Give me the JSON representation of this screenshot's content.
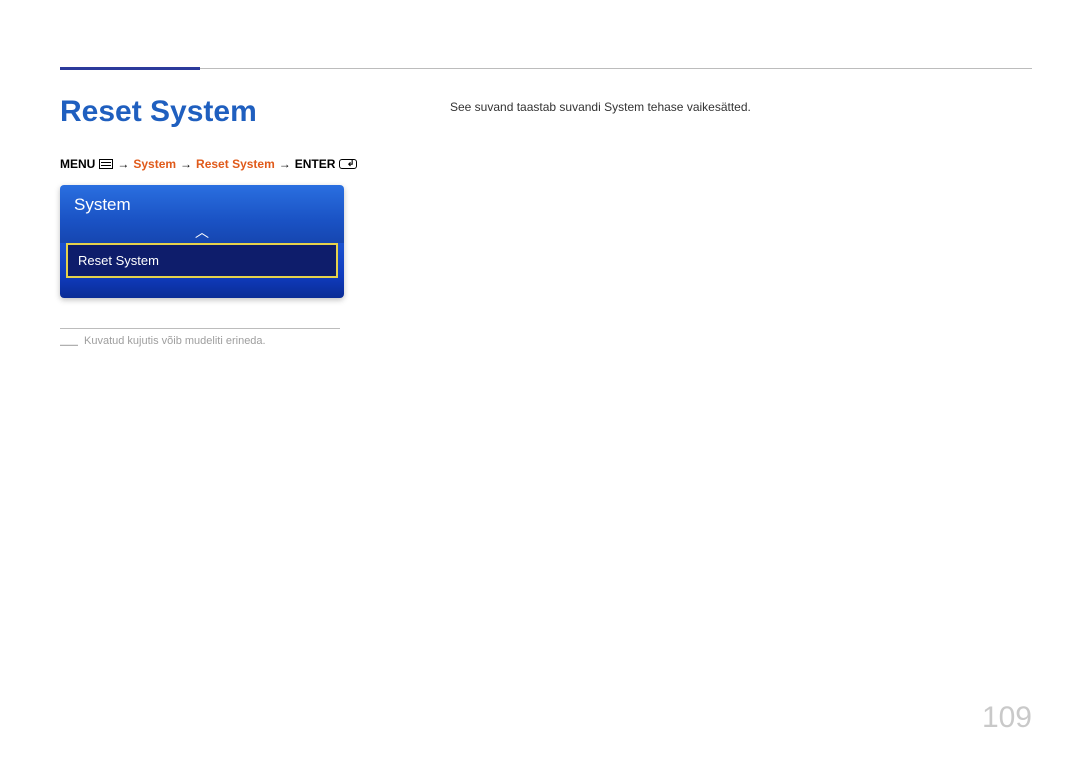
{
  "heading": "Reset System",
  "breadcrumb": {
    "menuLabel": "MENU",
    "arrow1": "→",
    "step1": "System",
    "arrow2": "→",
    "step2": "Reset System",
    "arrow3": "→",
    "enterLabel": "ENTER"
  },
  "osd": {
    "title": "System",
    "arrowUp": "︿",
    "selectedItem": "Reset System"
  },
  "footnote": {
    "dash": "―",
    "text": "Kuvatud kujutis võib mudeliti erineda."
  },
  "description": "See suvand taastab suvandi System tehase vaikesätted.",
  "pageNumber": "109"
}
